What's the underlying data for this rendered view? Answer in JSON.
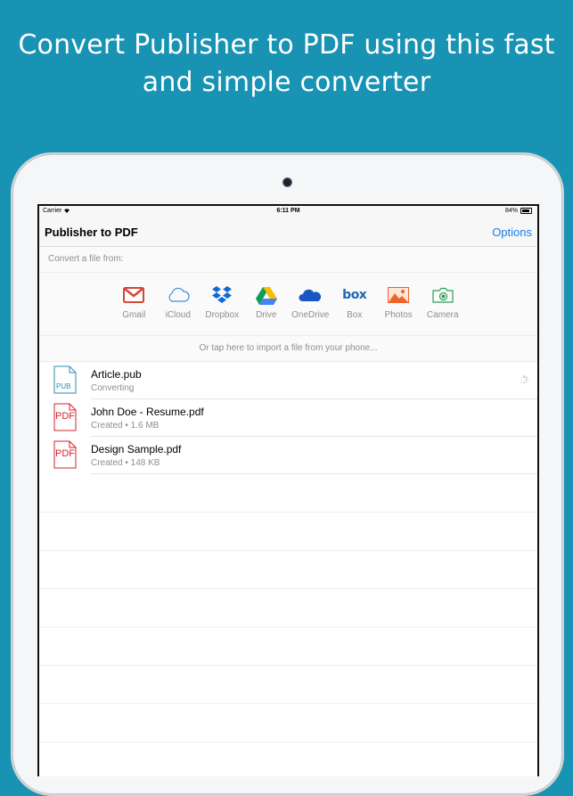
{
  "headline": {
    "line1": "Convert Publisher to PDF using this fast",
    "line2": "and simple converter"
  },
  "status_bar": {
    "carrier": "Carrier",
    "time": "6:11 PM",
    "battery": "84%"
  },
  "navbar": {
    "title": "Publisher to PDF",
    "options_label": "Options"
  },
  "convert_label": "Convert a file from:",
  "sources": [
    {
      "label": "Gmail",
      "icon": "gmail-icon",
      "color": "#d44638"
    },
    {
      "label": "iCloud",
      "icon": "icloud-icon",
      "color": "#3a8fe0"
    },
    {
      "label": "Dropbox",
      "icon": "dropbox-icon",
      "color": "#0d6bd8"
    },
    {
      "label": "Drive",
      "icon": "google-drive-icon",
      "color": "#fbbc04"
    },
    {
      "label": "OneDrive",
      "icon": "onedrive-icon",
      "color": "#1a56c4"
    },
    {
      "label": "Box",
      "icon": "box-icon",
      "color": "#1f67b5"
    },
    {
      "label": "Photos",
      "icon": "photos-icon",
      "color": "#f0642a"
    },
    {
      "label": "Camera",
      "icon": "camera-icon",
      "color": "#2f9e5a"
    }
  ],
  "import_hint": "Or tap here to import a file from your phone...",
  "files": [
    {
      "name": "Article.pub",
      "subtitle": "Converting",
      "badge": "PUB",
      "badge_color": "#2b8eae"
    },
    {
      "name": "John Doe - Resume.pdf",
      "subtitle": "Created • 1.6 MB",
      "badge": "PDF",
      "badge_color": "#d2232a"
    },
    {
      "name": "Design Sample.pdf",
      "subtitle": "Created • 148 KB",
      "badge": "PDF",
      "badge_color": "#d2232a"
    }
  ]
}
